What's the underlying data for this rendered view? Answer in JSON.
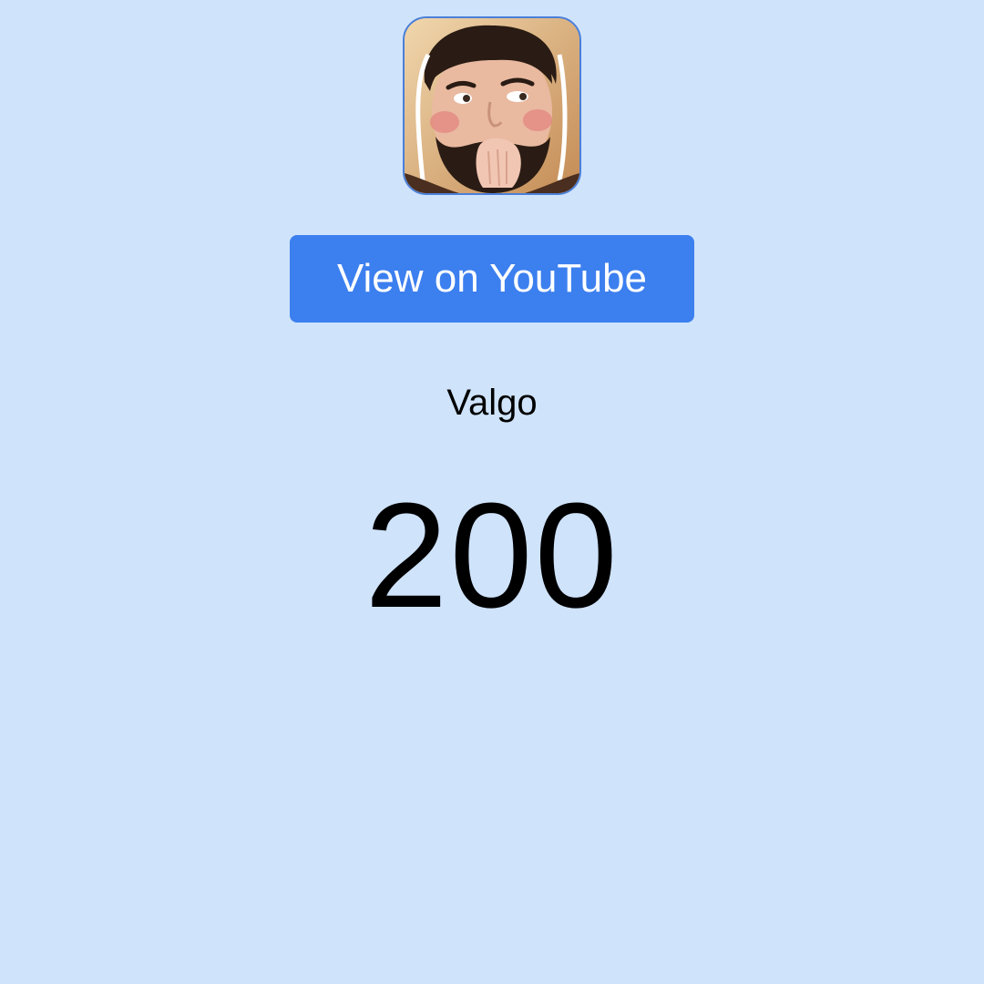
{
  "channel": {
    "avatar_icon": "channel-avatar-photo",
    "name": "Valgo",
    "count": "200"
  },
  "actions": {
    "youtube_label": "View on YouTube"
  },
  "colors": {
    "background": "#cfe3fb",
    "button": "#3c7fef",
    "avatar_border": "#4a7fd9"
  }
}
